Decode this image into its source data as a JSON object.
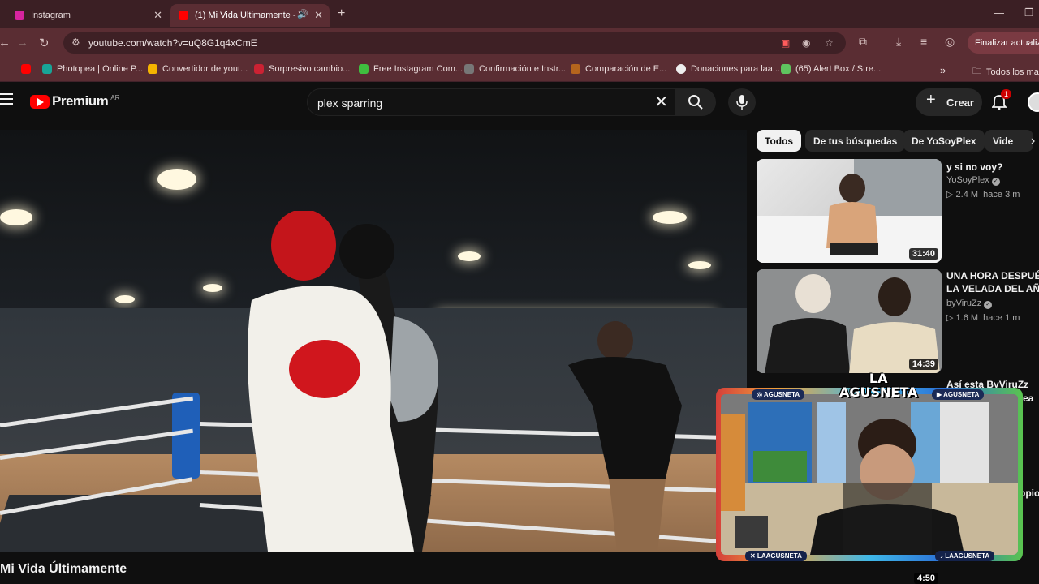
{
  "browser": {
    "tabs": [
      {
        "title": "Instagram",
        "favicon_color": "#d6249f"
      },
      {
        "title": "(1) Mi Vida Últimamente - Y",
        "favicon_color": "#ff0000"
      }
    ],
    "url": "youtube.com/watch?v=uQ8G1q4xCmE",
    "update_button": "Finalizar actualiz",
    "bookmarks": [
      {
        "label": "Photopea | Online P...",
        "color": "#18a497"
      },
      {
        "label": "Convertidor de yout...",
        "color": "#f5b400"
      },
      {
        "label": "Sorpresivo cambio...",
        "color": "#cc2233"
      },
      {
        "label": "Free Instagram Com...",
        "color": "#3fbf3f"
      },
      {
        "label": "Confirmación e Instr...",
        "color": "#777777"
      },
      {
        "label": "Comparación de E...",
        "color": "#b5651d"
      },
      {
        "label": "Donaciones para laa...",
        "color": "#eeeeee"
      },
      {
        "label": "(65) Alert Box / Stre...",
        "color": "#5fc45f"
      }
    ],
    "bookmarks_folder": "Todos los ma"
  },
  "header": {
    "logo_text": "Premium",
    "region": "AR",
    "search_query": "plex sparring",
    "create_label": "Crear",
    "notifications": "1"
  },
  "video": {
    "title": "Mi Vida Últimamente"
  },
  "chips": [
    "Todos",
    "De tus búsquedas",
    "De YoSoyPlex",
    "Vide"
  ],
  "recommendations": [
    {
      "title": "y si no voy?",
      "channel": "YoSoyPlex",
      "views": "2.4 M",
      "age": "hace 3 m",
      "duration": "31:40"
    },
    {
      "title": "UNA HORA DESPUÉS DE LA VELADA DEL AÑO",
      "title_line1": "UNA HORA DESPUÉS",
      "title_line2": "LA VELADA DEL AÑO",
      "channel": "byViruZz",
      "views": "1.6 M",
      "age": "hace 1 m",
      "duration": "14:39"
    }
  ],
  "partial_text": {
    "third_title": "Así esta ByViruZz",
    "frag1": "ea",
    "frag2": "opio",
    "duration3": "4:50"
  },
  "webcam": {
    "brand": "LA AGUSNETA",
    "brand_line1": "LA",
    "brand_line2": "AGUSNETA",
    "tag_instagram": "◎ AGUSNETA",
    "tag_youtube": "▶ AGUSNETA",
    "tag_x": "✕ LAAGUSNETA",
    "tag_tiktok": "♪ LAAGUSNETA"
  }
}
